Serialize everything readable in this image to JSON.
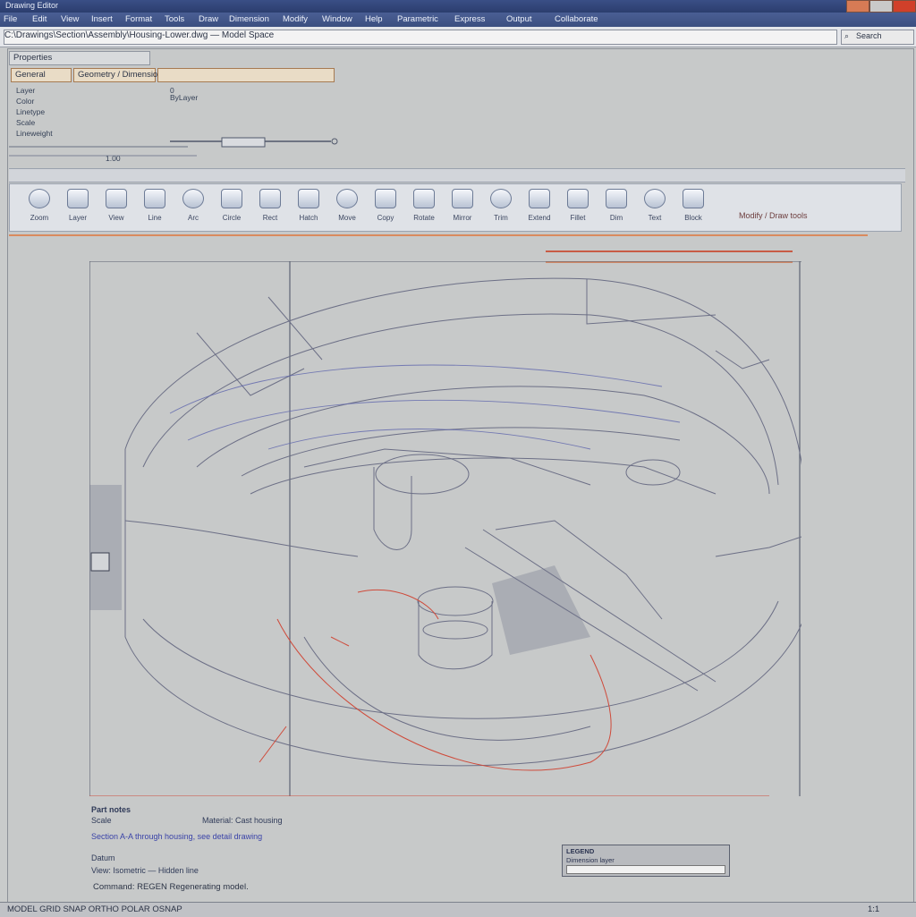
{
  "titlebar": {
    "title": "Drawing Editor"
  },
  "menubar": {
    "items": [
      "File",
      "Edit",
      "View",
      "Insert",
      "Format",
      "Tools",
      "Draw",
      "Dimension",
      "Modify",
      "Window",
      "Help",
      "Parametric",
      "Express",
      "Output",
      "Collaborate"
    ]
  },
  "pathbar": {
    "path": "C:\\Drawings\\Section\\Assembly\\Housing-Lower.dwg — Model Space",
    "side": "Search"
  },
  "properties": {
    "tab": "Properties",
    "field1": "General",
    "field2": "Geometry / Dimension Style",
    "labels": [
      "Layer",
      "Color",
      "Linetype",
      "Scale",
      "Lineweight"
    ],
    "values": [
      "0",
      "ByLayer",
      "1.00"
    ]
  },
  "toolbar": {
    "tools": [
      {
        "name": "zoom-tool-icon",
        "label": "Zoom"
      },
      {
        "name": "layer-tool-icon",
        "label": "Layer"
      },
      {
        "name": "view-tool-icon",
        "label": "View"
      },
      {
        "name": "line-tool-icon",
        "label": "Line"
      },
      {
        "name": "arc-tool-icon",
        "label": "Arc"
      },
      {
        "name": "circle-tool-icon",
        "label": "Circle"
      },
      {
        "name": "rect-tool-icon",
        "label": "Rect"
      },
      {
        "name": "hatch-tool-icon",
        "label": "Hatch"
      },
      {
        "name": "move-tool-icon",
        "label": "Move"
      },
      {
        "name": "copy-tool-icon",
        "label": "Copy"
      },
      {
        "name": "rotate-tool-icon",
        "label": "Rotate"
      },
      {
        "name": "mirror-tool-icon",
        "label": "Mirror"
      },
      {
        "name": "trim-tool-icon",
        "label": "Trim"
      },
      {
        "name": "extend-tool-icon",
        "label": "Extend"
      },
      {
        "name": "fillet-tool-icon",
        "label": "Fillet"
      },
      {
        "name": "dim-tool-icon",
        "label": "Dim"
      },
      {
        "name": "text-tool-icon",
        "label": "Text"
      },
      {
        "name": "block-tool-icon",
        "label": "Block"
      }
    ],
    "status": "Modify / Draw tools"
  },
  "bottom": {
    "heading": "Part notes",
    "line1": "Scale",
    "line2": "Material: Cast housing",
    "line3": "Section A-A through housing, see detail drawing",
    "line4": "Datum",
    "line5": "View: Isometric — Hidden line",
    "legend_title": "LEGEND",
    "legend_line": "Dimension layer"
  },
  "cmdline": "Command: REGEN  Regenerating model.",
  "statusbar": {
    "left": "MODEL  GRID  SNAP  ORTHO  POLAR  OSNAP",
    "right": "1:1"
  },
  "colors": {
    "accent_red": "#cf4a3a",
    "sketch_blue": "#5a62a8"
  }
}
